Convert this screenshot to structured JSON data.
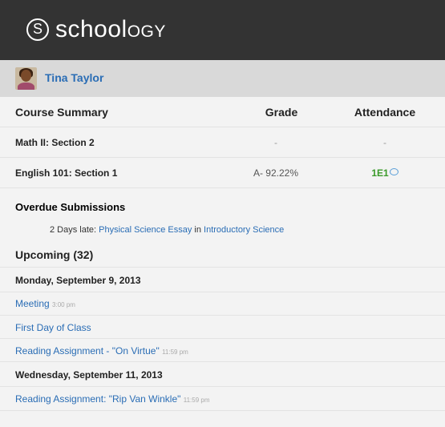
{
  "logo": {
    "glyph": "S",
    "text_main": "school",
    "text_suffix": "ogy"
  },
  "user": {
    "name": "Tina Taylor"
  },
  "summary": {
    "headers": {
      "course": "Course Summary",
      "grade": "Grade",
      "attendance": "Attendance"
    },
    "rows": [
      {
        "course": "Math II: Section 2",
        "grade": "-",
        "attendance": "-"
      },
      {
        "course": "English 101: Section 1",
        "grade": "A- 92.22%",
        "attendance": "1E1"
      }
    ]
  },
  "overdue": {
    "title": "Overdue Submissions",
    "items": [
      {
        "late": "2 Days late:",
        "assignment": "Physical Science Essay",
        "in_word": "in",
        "course": "Introductory Science"
      }
    ]
  },
  "upcoming": {
    "title": "Upcoming (32)",
    "groups": [
      {
        "date": "Monday, September 9, 2013",
        "events": [
          {
            "title": "Meeting",
            "time": "3:00 pm"
          },
          {
            "title": "First Day of Class",
            "time": ""
          },
          {
            "title": "Reading Assignment - \"On Virtue\"",
            "time": "11:59 pm"
          }
        ]
      },
      {
        "date": "Wednesday, September 11, 2013",
        "events": [
          {
            "title": "Reading Assignment: \"Rip Van Winkle\"",
            "time": "11:59 pm"
          }
        ]
      }
    ]
  }
}
